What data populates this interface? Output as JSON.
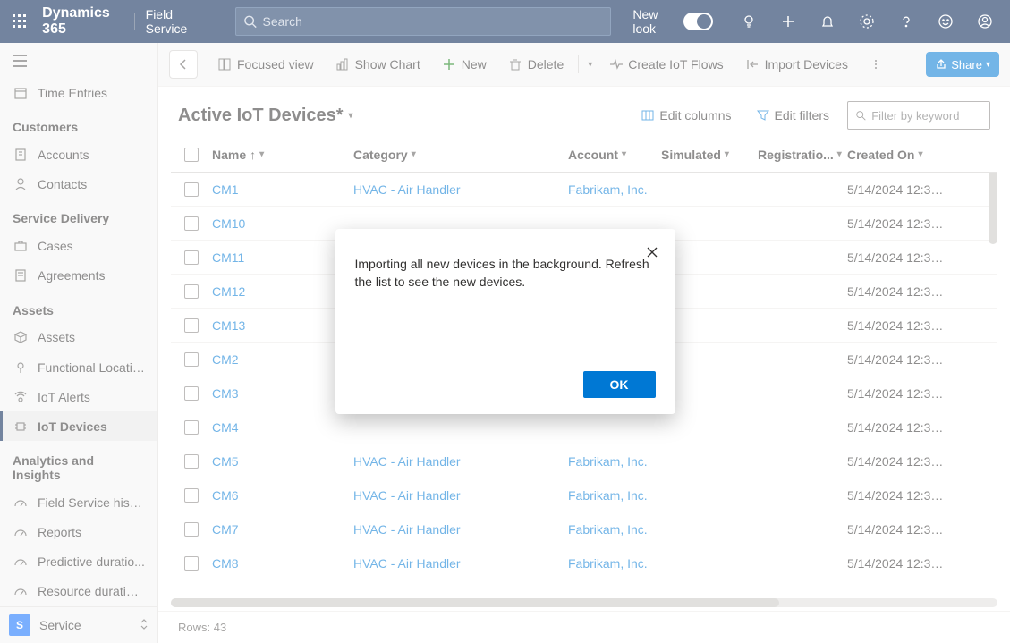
{
  "topbar": {
    "brand": "Dynamics 365",
    "app": "Field Service",
    "search_placeholder": "Search",
    "new_look": "New look"
  },
  "sidebar": {
    "time_entries": "Time Entries",
    "group_customers": "Customers",
    "accounts": "Accounts",
    "contacts": "Contacts",
    "group_service": "Service Delivery",
    "cases": "Cases",
    "agreements": "Agreements",
    "group_assets": "Assets",
    "assets": "Assets",
    "func_loc": "Functional Locatio...",
    "iot_alerts": "IoT Alerts",
    "iot_devices": "IoT Devices",
    "group_analytics": "Analytics and Insights",
    "fs_history": "Field Service histo...",
    "reports": "Reports",
    "pred_dur": "Predictive duratio...",
    "res_dur": "Resource duration...",
    "area_badge": "S",
    "area_label": "Service"
  },
  "cmdbar": {
    "focused": "Focused view",
    "chart": "Show Chart",
    "new": "New",
    "delete": "Delete",
    "flows": "Create IoT Flows",
    "import": "Import Devices",
    "share": "Share"
  },
  "subhead": {
    "title": "Active IoT Devices*",
    "edit_cols": "Edit columns",
    "edit_filters": "Edit filters",
    "filter_placeholder": "Filter by keyword"
  },
  "grid": {
    "head": {
      "name": "Name",
      "category": "Category",
      "account": "Account",
      "simulated": "Simulated",
      "registration": "Registratio...",
      "created": "Created On"
    },
    "rows": [
      {
        "name": "CM1",
        "category": "HVAC - Air Handler",
        "account": "Fabrikam, Inc.",
        "created": "5/14/2024 12:37 ..."
      },
      {
        "name": "CM10",
        "category": "",
        "account": "",
        "created": "5/14/2024 12:37 ..."
      },
      {
        "name": "CM11",
        "category": "",
        "account": "",
        "created": "5/14/2024 12:37 ..."
      },
      {
        "name": "CM12",
        "category": "",
        "account": "",
        "created": "5/14/2024 12:37 ..."
      },
      {
        "name": "CM13",
        "category": "",
        "account": "",
        "created": "5/14/2024 12:37 ..."
      },
      {
        "name": "CM2",
        "category": "",
        "account": "",
        "created": "5/14/2024 12:37 ..."
      },
      {
        "name": "CM3",
        "category": "",
        "account": "",
        "created": "5/14/2024 12:37 ..."
      },
      {
        "name": "CM4",
        "category": "",
        "account": "",
        "created": "5/14/2024 12:37 ..."
      },
      {
        "name": "CM5",
        "category": "HVAC - Air Handler",
        "account": "Fabrikam, Inc.",
        "created": "5/14/2024 12:37 ..."
      },
      {
        "name": "CM6",
        "category": "HVAC - Air Handler",
        "account": "Fabrikam, Inc.",
        "created": "5/14/2024 12:37 ..."
      },
      {
        "name": "CM7",
        "category": "HVAC - Air Handler",
        "account": "Fabrikam, Inc.",
        "created": "5/14/2024 12:37 ..."
      },
      {
        "name": "CM8",
        "category": "HVAC - Air Handler",
        "account": "Fabrikam, Inc.",
        "created": "5/14/2024 12:37 ..."
      }
    ],
    "footer": "Rows: 43"
  },
  "modal": {
    "text": "Importing all new devices in the background. Refresh the list to see the new devices.",
    "ok": "OK"
  }
}
